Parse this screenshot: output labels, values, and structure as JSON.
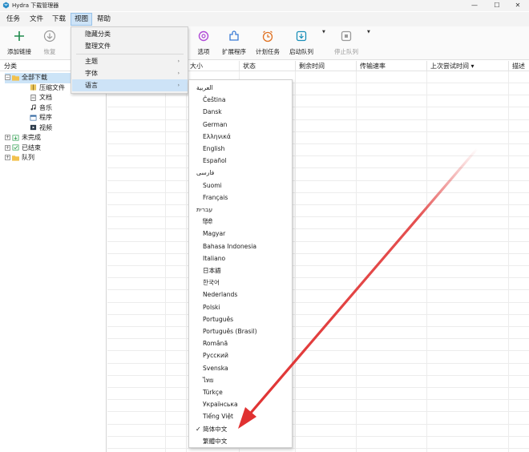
{
  "window": {
    "title": "Hydra 下载管理器",
    "minimize_glyph": "—",
    "maximize_glyph": "☐",
    "close_glyph": "✕"
  },
  "menubar": {
    "task": "任务",
    "file": "文件",
    "download": "下载",
    "view": "视图",
    "help": "帮助"
  },
  "toolbar": {
    "add_link": "添加链接",
    "resume": "恢复",
    "options": "选项",
    "extensions": "扩展程序",
    "scheduler": "计划任务",
    "start_queue": "启动队列",
    "stop_queue": "停止队列",
    "dropdown_glyph": "▼"
  },
  "view_menu": {
    "hide_categories": "隐藏分类",
    "organize_files": "整理文件",
    "theme": "主题",
    "font": "字体",
    "language": "语言",
    "submenu_glyph": "›"
  },
  "left_pane": {
    "header": "分类",
    "all_downloads": "全部下载",
    "compressed": "压缩文件",
    "documents": "文档",
    "music": "音乐",
    "programs": "程序",
    "videos": "视频",
    "unfinished": "未完成",
    "finished": "已结束",
    "queues": "队列",
    "collapse_glyph": "−",
    "expand_glyph": "+"
  },
  "table": {
    "columns": [
      "大小",
      "状态",
      "剩余时间",
      "传输速率",
      "上次尝试时间",
      "描述"
    ],
    "sort_indicator": "▾"
  },
  "language_menu": {
    "items": [
      "العربية",
      "Čeština",
      "Dansk",
      "German",
      "Ελληνικά",
      "English",
      "Español",
      "فارسی",
      "Suomi",
      "Français",
      "עברית",
      "हिंदी",
      "Magyar",
      "Bahasa Indonesia",
      "Italiano",
      "日本語",
      "한국어",
      "Nederlands",
      "Polski",
      "Português",
      "Português (Brasil)",
      "Română",
      "Русский",
      "Svenska",
      "ไทย",
      "Türkçe",
      "Українська",
      "Tiếng Việt",
      "简体中文",
      "繁體中文"
    ],
    "rtl": [
      0,
      7,
      10
    ],
    "checked_index": 28,
    "check_glyph": "✓"
  },
  "colors": {
    "accent": "#0078d4",
    "annotation": "#e03131"
  }
}
